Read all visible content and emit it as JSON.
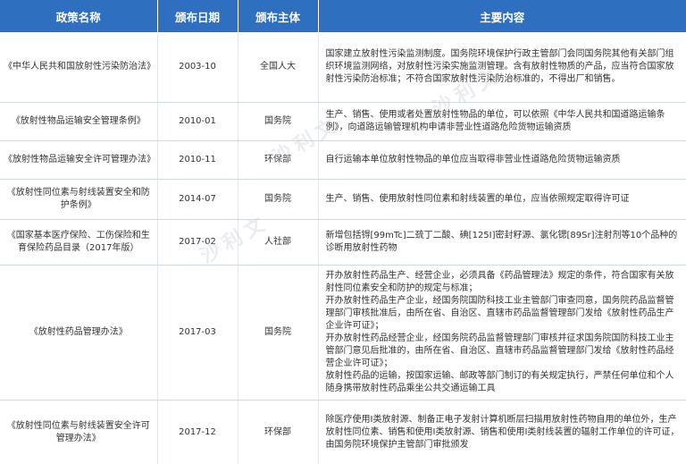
{
  "header": {
    "col_name": "政策名称",
    "col_date": "颁布日期",
    "col_org": "颁布主体",
    "col_content": "主要内容"
  },
  "rows": [
    {
      "name": "《中华人民共和国放射性污染防治法》",
      "date": "2003-10",
      "org": "全国人大",
      "content": "国家建立放射性污染监测制度。国务院环境保护行政主管部门会同国务院其他有关部门组织环境监测网络，对放射性污染实施监测管理。含有放射性物质的产品，应当符合国家放射性污染防治标准；不符合国家放射性污染防治标准的，不得出厂和销售。"
    },
    {
      "name": "《放射性物品运输安全管理条例》",
      "date": "2010-01",
      "org": "国务院",
      "content": "生产、销售、使用或者处置放射性物品的单位，可以依照《中华人民共和国道路运输条例》，向道路运输管理机构申请非营业性道路危险货物运输资质"
    },
    {
      "name": "《放射性物品运输安全许可管理办法》",
      "date": "2010-11",
      "org": "环保部",
      "content": "自行运输本单位放射性物品的单位应当取得非营业性道路危险货物运输资质"
    },
    {
      "name": "《放射性同位素与射线装置安全和防护条例》",
      "date": "2014-07",
      "org": "国务院",
      "content": "生产、销售、使用放射性同位素和射线装置的单位，应当依照规定取得许可证"
    },
    {
      "name": "《国家基本医疗保险、工伤保险和生育保险药品目录（2017年版）",
      "date": "2017-02",
      "org": "人社部",
      "content": "新增包括锝[99mTc]二巯丁二酸、碘[125I]密封籽源、氯化锶[89Sr]注射剂等10个品种的诊断用放射性药物"
    },
    {
      "name": "《放射性药品管理办法》",
      "date": "2017-03",
      "org": "国务院",
      "content": "开办放射性药品生产、经营企业，必须具备《药品管理法》规定的条件，符合国家有关放射性同位素安全和防护的规定与标准；\n开办放射性药品生产企业，经国务院国防科技工业主管部门审查同意，国务院药品监督管理部门审核批准后，由所在省、自治区、直辖市药品监督管理部门发给《放射性药品生产企业许可证》；\n开办放射性药品经营企业，经国务院药品监督管理部门审核并征求国务院国防科技工业主管部门意见后批准的，由所在省、自治区、直辖市药品监督管理部门发给《放射性药品经营企业许可证》；\n放射性药品的运输，按国家运输、邮政等部门制订的有关规定执行，严禁任何单位和个人随身携带放射性药品乘坐公共交通运输工具"
    },
    {
      "name": "《放射性同位素与射线装置安全许可管理办法》",
      "date": "2017-12",
      "org": "环保部",
      "content": "除医疗使用Ⅰ类放射源、制备正电子发射计算机断层扫描用放射性药物自用的单位外，生产放射性同位素、销售和使用Ⅰ类放射源、销售和使用Ⅰ类射线装置的辐射工作单位的许可证，由国务院环境保护主管部门审批颁发"
    }
  ],
  "watermark": "沙利文"
}
